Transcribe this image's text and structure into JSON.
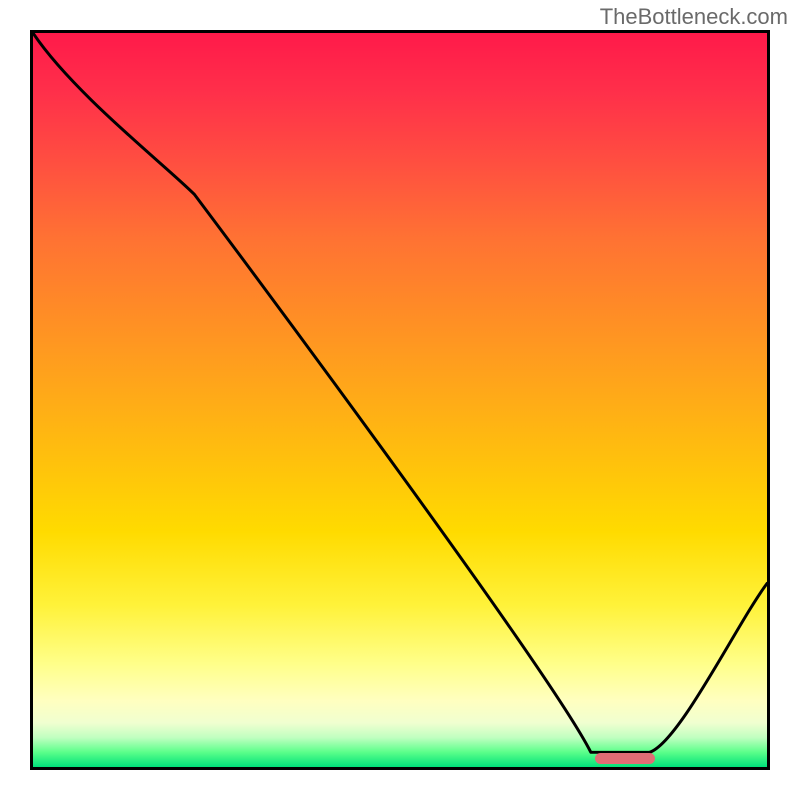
{
  "watermark": "TheBottleneck.com",
  "chart_data": {
    "type": "line",
    "title": "",
    "xlabel": "",
    "ylabel": "",
    "xlim": [
      0,
      100
    ],
    "ylim": [
      0,
      100
    ],
    "x": [
      0,
      22,
      76,
      84,
      100
    ],
    "values": [
      100,
      78,
      2,
      2,
      25
    ],
    "optimal_marker": {
      "x_start": 76,
      "x_end": 84,
      "y": 2
    },
    "gradient_stops": [
      {
        "pct": 0,
        "color": "#ff1a4a"
      },
      {
        "pct": 50,
        "color": "#ffb300"
      },
      {
        "pct": 85,
        "color": "#ffff80"
      },
      {
        "pct": 100,
        "color": "#00e07a"
      }
    ]
  }
}
